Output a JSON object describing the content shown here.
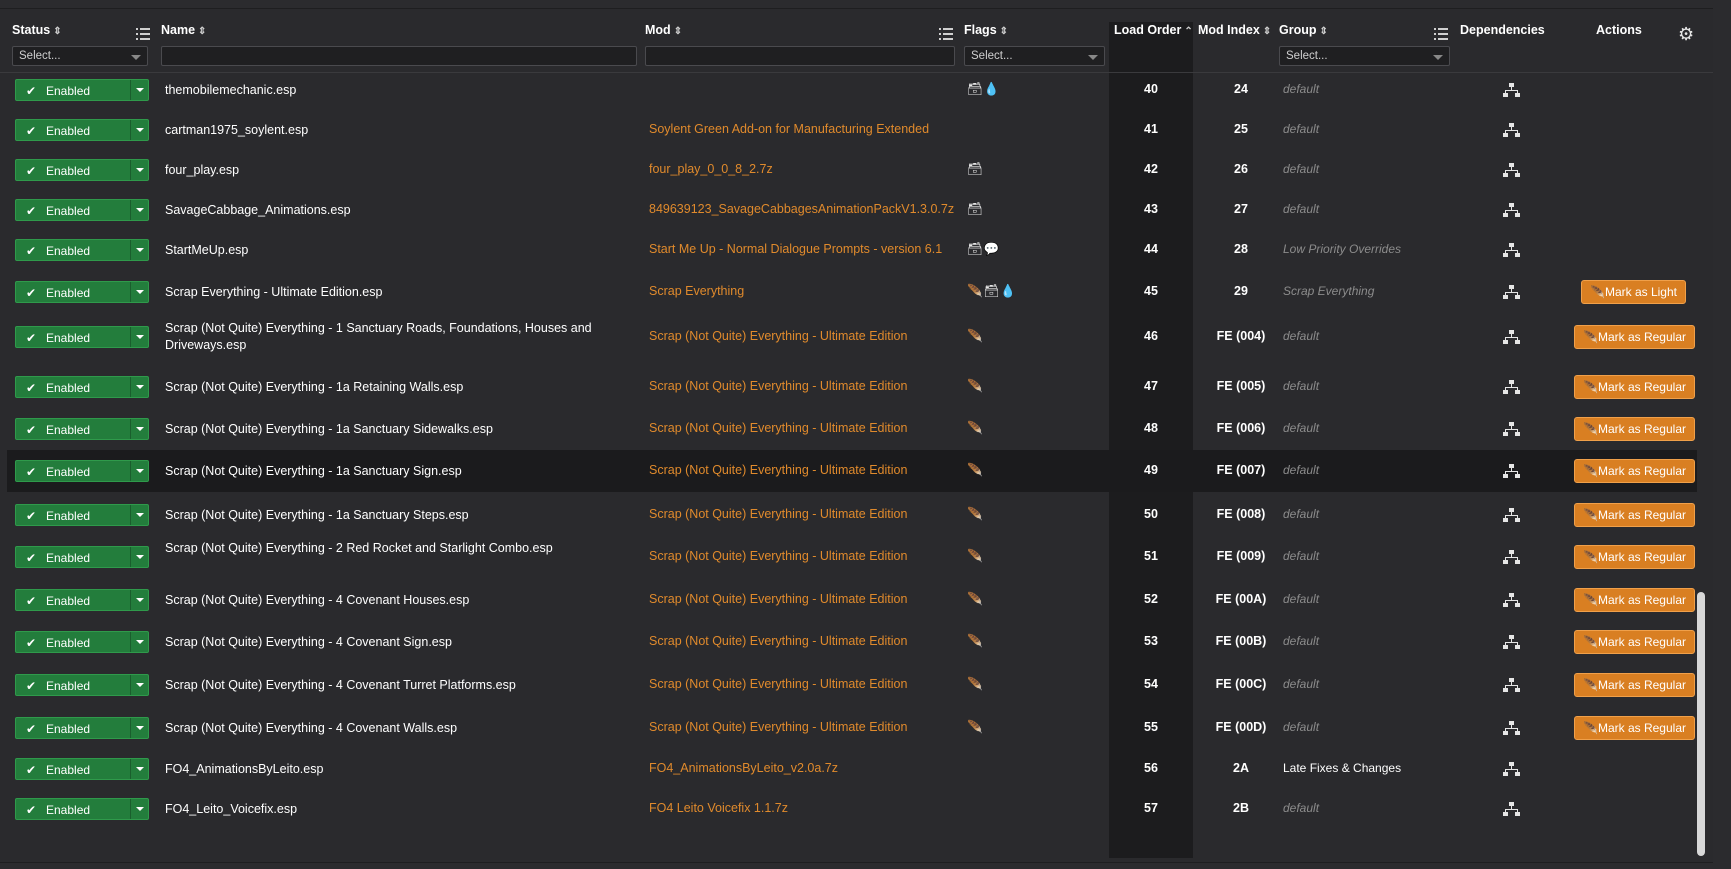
{
  "columns": {
    "status": "Status",
    "name": "Name",
    "mod": "Mod",
    "flags": "Flags",
    "load_order": "Load Order",
    "mod_index": "Mod Index",
    "group": "Group",
    "dependencies": "Dependencies",
    "actions": "Actions"
  },
  "filters": {
    "status_placeholder": "Select...",
    "flags_placeholder": "Select...",
    "group_placeholder": "Select..."
  },
  "icons": {
    "sort": "sort-icon",
    "column_menu": "list-icon",
    "settings": "gear-icon",
    "dependencies": "sitemap-icon",
    "status": "check-icon"
  },
  "colors": {
    "enabled": "#237d3c",
    "mod_link": "#e08a2c",
    "action_button": "#d97f22"
  },
  "rows": [
    {
      "status": "Enabled",
      "name": "themobilemechanic.esp",
      "mod": "",
      "flags": "🗃💧",
      "load_order": "40",
      "mod_index": "24",
      "group": "default",
      "action": ""
    },
    {
      "status": "Enabled",
      "name": "cartman1975_soylent.esp",
      "mod": "Soylent Green Add-on for Manufacturing Extended",
      "flags": "",
      "load_order": "41",
      "mod_index": "25",
      "group": "default",
      "action": ""
    },
    {
      "status": "Enabled",
      "name": "four_play.esp",
      "mod": "four_play_0_0_8_2.7z",
      "flags": "🗃",
      "load_order": "42",
      "mod_index": "26",
      "group": "default",
      "action": ""
    },
    {
      "status": "Enabled",
      "name": "SavageCabbage_Animations.esp",
      "mod": "849639123_SavageCabbagesAnimationPackV1.3.0.7z",
      "flags": "🗃",
      "load_order": "43",
      "mod_index": "27",
      "group": "default",
      "action": ""
    },
    {
      "status": "Enabled",
      "name": "StartMeUp.esp",
      "mod": "Start Me Up - Normal Dialogue Prompts - version 6.1",
      "flags": "🗃💬",
      "load_order": "44",
      "mod_index": "28",
      "group": "Low Priority Overrides",
      "action": ""
    },
    {
      "status": "Enabled",
      "name": "Scrap Everything - Ultimate Edition.esp",
      "mod": "Scrap Everything",
      "flags": "🪶🗃💧",
      "load_order": "45",
      "mod_index": "29",
      "group": "Scrap Everything",
      "action": "Mark as Light"
    },
    {
      "status": "Enabled",
      "name": "Scrap (Not Quite) Everything - 1 Sanctuary Roads, Foundations, Houses and Driveways.esp",
      "mod": "Scrap (Not Quite) Everything - Ultimate Edition",
      "flags": "🪶",
      "load_order": "46",
      "mod_index": "FE (004)",
      "group": "default",
      "action": "Mark as Regular"
    },
    {
      "status": "Enabled",
      "name": "Scrap (Not Quite) Everything - 1a Retaining Walls.esp",
      "mod": "Scrap (Not Quite) Everything - Ultimate Edition",
      "flags": "🪶",
      "load_order": "47",
      "mod_index": "FE (005)",
      "group": "default",
      "action": "Mark as Regular"
    },
    {
      "status": "Enabled",
      "name": "Scrap (Not Quite) Everything - 1a Sanctuary Sidewalks.esp",
      "mod": "Scrap (Not Quite) Everything - Ultimate Edition",
      "flags": "🪶",
      "load_order": "48",
      "mod_index": "FE (006)",
      "group": "default",
      "action": "Mark as Regular"
    },
    {
      "status": "Enabled",
      "name": "Scrap (Not Quite) Everything - 1a Sanctuary Sign.esp",
      "mod": "Scrap (Not Quite) Everything - Ultimate Edition",
      "flags": "🪶",
      "load_order": "49",
      "mod_index": "FE (007)",
      "group": "default",
      "action": "Mark as Regular"
    },
    {
      "status": "Enabled",
      "name": "Scrap (Not Quite) Everything - 1a Sanctuary Steps.esp",
      "mod": "Scrap (Not Quite) Everything - Ultimate Edition",
      "flags": "🪶",
      "load_order": "50",
      "mod_index": "FE (008)",
      "group": "default",
      "action": "Mark as Regular"
    },
    {
      "status": "Enabled",
      "name": "Scrap (Not Quite) Everything - 2 Red Rocket and Starlight Combo.esp",
      "mod": "Scrap (Not Quite) Everything - Ultimate Edition",
      "flags": "🪶",
      "load_order": "51",
      "mod_index": "FE (009)",
      "group": "default",
      "action": "Mark as Regular"
    },
    {
      "status": "Enabled",
      "name": "Scrap (Not Quite) Everything - 4 Covenant Houses.esp",
      "mod": "Scrap (Not Quite) Everything - Ultimate Edition",
      "flags": "🪶",
      "load_order": "52",
      "mod_index": "FE (00A)",
      "group": "default",
      "action": "Mark as Regular"
    },
    {
      "status": "Enabled",
      "name": "Scrap (Not Quite) Everything - 4 Covenant Sign.esp",
      "mod": "Scrap (Not Quite) Everything - Ultimate Edition",
      "flags": "🪶",
      "load_order": "53",
      "mod_index": "FE (00B)",
      "group": "default",
      "action": "Mark as Regular"
    },
    {
      "status": "Enabled",
      "name": "Scrap (Not Quite) Everything - 4 Covenant Turret Platforms.esp",
      "mod": "Scrap (Not Quite) Everything - Ultimate Edition",
      "flags": "🪶",
      "load_order": "54",
      "mod_index": "FE (00C)",
      "group": "default",
      "action": "Mark as Regular"
    },
    {
      "status": "Enabled",
      "name": "Scrap (Not Quite) Everything - 4 Covenant Walls.esp",
      "mod": "Scrap (Not Quite) Everything - Ultimate Edition",
      "flags": "🪶",
      "load_order": "55",
      "mod_index": "FE (00D)",
      "group": "default",
      "action": "Mark as Regular"
    },
    {
      "status": "Enabled",
      "name": "FO4_AnimationsByLeito.esp",
      "mod": "FO4_AnimationsByLeito_v2.0a.7z",
      "flags": "",
      "load_order": "56",
      "mod_index": "2A",
      "group": "Late Fixes & Changes",
      "action": ""
    },
    {
      "status": "Enabled",
      "name": "FO4_Leito_Voicefix.esp",
      "mod": "FO4 Leito Voicefix 1.1.7z",
      "flags": "",
      "load_order": "57",
      "mod_index": "2B",
      "group": "default",
      "action": ""
    }
  ]
}
